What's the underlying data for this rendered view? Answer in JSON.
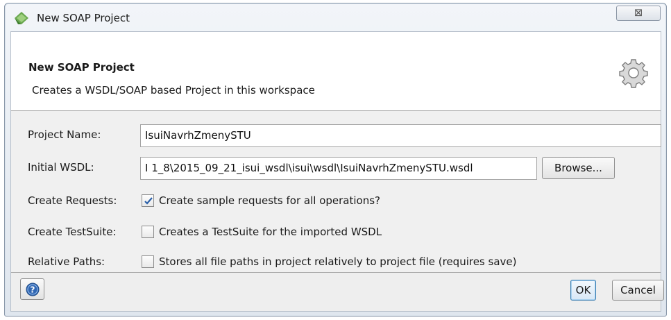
{
  "window": {
    "title": "New SOAP Project",
    "close_glyph": "⊠",
    "app_icon": "soapui-logo-icon"
  },
  "header": {
    "title": "New SOAP Project",
    "description": "Creates a WSDL/SOAP based Project in this workspace",
    "icon": "gear-icon"
  },
  "form": {
    "project_name": {
      "label": "Project Name:",
      "value": "IsuiNavrhZmenySTU"
    },
    "initial_wsdl": {
      "label": "Initial WSDL:",
      "value": "I 1_8\\2015_09_21_isui_wsdl\\isui\\wsdl\\IsuiNavrhZmenySTU.wsdl",
      "browse_label": "Browse..."
    },
    "create_requests": {
      "label": "Create Requests:",
      "text": "Create sample requests for all operations?",
      "checked": true
    },
    "create_testsuite": {
      "label": "Create TestSuite:",
      "text": "Creates a TestSuite for the imported WSDL",
      "checked": false
    },
    "relative_paths": {
      "label": "Relative Paths:",
      "text": "Stores all file paths in project relatively to project file (requires save)",
      "checked": false
    }
  },
  "footer": {
    "help_icon": "help-icon",
    "ok_label": "OK",
    "cancel_label": "Cancel"
  },
  "colors": {
    "check_mark": "#2a5fa8",
    "help_blue": "#2f66b3",
    "titlebar": "#e8eef5"
  }
}
